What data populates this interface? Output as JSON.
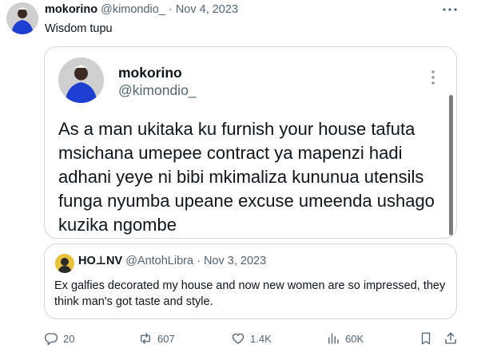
{
  "tweet": {
    "author_name": "mokorino",
    "author_handle": "@kimondio_",
    "separator": "·",
    "date": "Nov 4, 2023",
    "text": "Wisdom tupu"
  },
  "embedded_screenshot": {
    "author_name": "mokorino",
    "author_handle": "@kimondio_",
    "text": "As a man ukitaka ku furnish your house tafuta msichana umepee contract ya mapenzi hadi adhani yeye ni bibi mkimaliza kununua utensils funga nyumba upeane excuse  umeenda ushago kuzika ngombe"
  },
  "quoted_tweet": {
    "author_name": "HO⊥NV",
    "author_handle": "@AntohLibra",
    "separator": "·",
    "date": "Nov 3, 2023",
    "text": "Ex galfies decorated my house and now new women are so impressed, they think man's got taste and style."
  },
  "actions": {
    "replies": "20",
    "reposts": "607",
    "likes": "1.4K",
    "views": "60K"
  },
  "icons": {
    "reply": "reply-icon",
    "repost": "repost-icon",
    "like": "like-icon",
    "views": "views-icon",
    "bookmark": "bookmark-icon",
    "share": "share-icon",
    "more": "more-icon"
  },
  "colors": {
    "text_primary": "#0f1419",
    "text_secondary": "#536471",
    "border": "#cfd9de"
  }
}
